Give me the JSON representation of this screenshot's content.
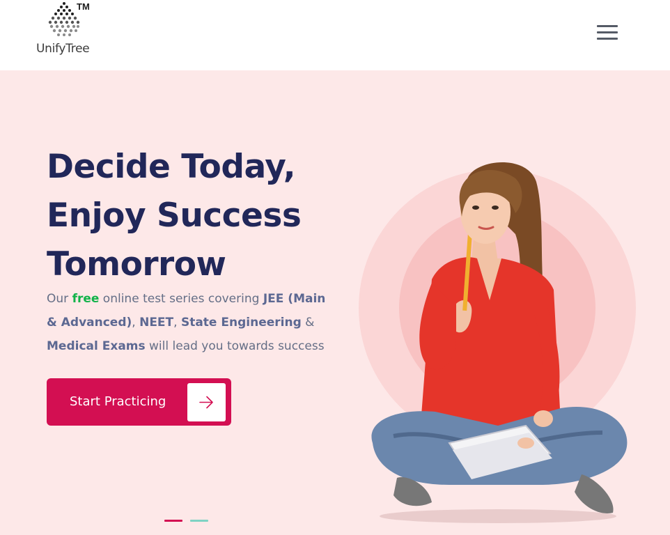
{
  "brand": {
    "name": "UnifyTree",
    "trademark": "TM"
  },
  "nav": {
    "menu_icon": "hamburger-menu-icon"
  },
  "hero": {
    "headline": [
      "Decide Today,",
      "Enjoy Success",
      "Tomorrow"
    ],
    "description": {
      "part1": "Our ",
      "free": "free",
      "part2": " online test series covering ",
      "jee": "JEE (Main & Advanced)",
      "comma1": ", ",
      "neet": "NEET",
      "comma2": ", ",
      "state": "State Engineering",
      "amp": " & ",
      "medical": "Medical Exams",
      "part3": " will lead you towards success"
    },
    "cta_label": "Start Practicing",
    "cta_icon": "arrow-right-icon"
  },
  "slider": {
    "dots": [
      {
        "active": true,
        "color": "#d30f52"
      },
      {
        "active": false,
        "color": "#7fd3c4"
      }
    ]
  },
  "colors": {
    "accent": "#d30f52",
    "heading": "#212759",
    "free": "#12b34a",
    "hero_bg": "#fde8e8"
  }
}
